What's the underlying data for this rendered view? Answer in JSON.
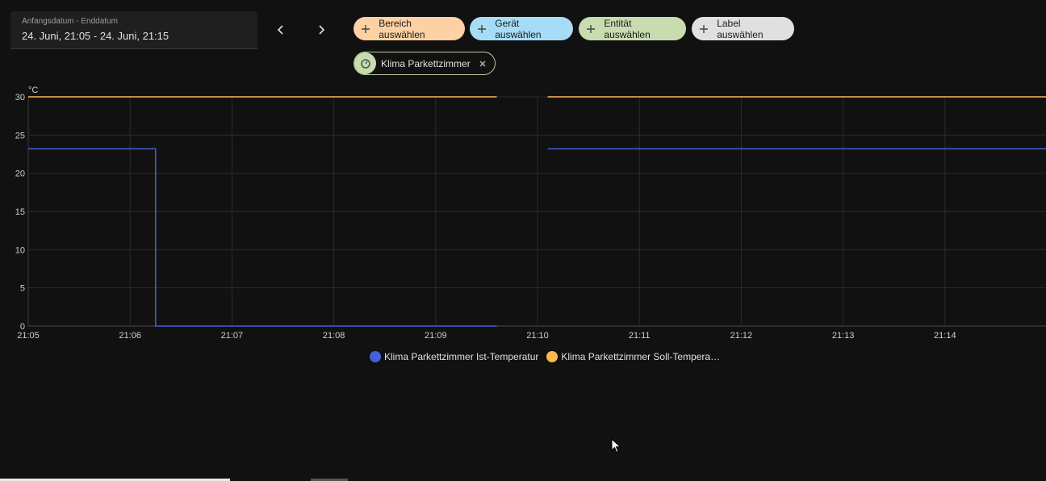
{
  "date_picker": {
    "label": "Anfangsdatum - Enddatum",
    "value": "24. Juni, 21:05 - 24. Juni, 21:15"
  },
  "nav": {
    "prev_icon": "chevron-left-icon",
    "next_icon": "chevron-right-icon"
  },
  "target_chips": [
    {
      "label": "Bereich auswählen",
      "color": "#fdd1a4"
    },
    {
      "label": "Gerät auswählen",
      "color": "#a7dcf7"
    },
    {
      "label": "Entität auswählen",
      "color": "#c8dcb0"
    },
    {
      "label": "Label auswählen",
      "color": "#e0e0e0"
    }
  ],
  "selected_entity": {
    "label": "Klima Parkettzimmer",
    "icon": "thermostat-icon"
  },
  "chart_data": {
    "type": "line",
    "unit": "°C",
    "x_ticks": [
      "21:05",
      "21:06",
      "21:07",
      "21:08",
      "21:09",
      "21:10",
      "21:11",
      "21:12",
      "21:13",
      "21:14"
    ],
    "y_ticks": [
      "0",
      "5",
      "10",
      "15",
      "20",
      "25",
      "30"
    ],
    "ylim": [
      0,
      30
    ],
    "xlim_minutes": [
      0,
      10
    ],
    "grid": true,
    "series": [
      {
        "name": "Klima Parkettzimmer Ist-Temperatur",
        "color": "#4361d8",
        "step": true,
        "segments": [
          [
            [
              0,
              23.2
            ],
            [
              1.25,
              23.2
            ],
            [
              1.25,
              0
            ],
            [
              4.6,
              0
            ]
          ],
          [
            [
              5.1,
              23.2
            ],
            [
              10,
              23.2
            ]
          ]
        ]
      },
      {
        "name": "Klima Parkettzimmer Soll-Temperatur",
        "color": "#ffb84d",
        "step": true,
        "segments": [
          [
            [
              0,
              30
            ],
            [
              4.6,
              30
            ]
          ],
          [
            [
              5.1,
              30
            ],
            [
              10,
              30
            ]
          ]
        ]
      }
    ]
  },
  "legend": [
    {
      "label": "Klima Parkettzimmer Ist-Temperatur",
      "color": "#4361d8"
    },
    {
      "label": "Klima Parkettzimmer Soll-Tempera…",
      "color": "#ffb84d"
    }
  ]
}
